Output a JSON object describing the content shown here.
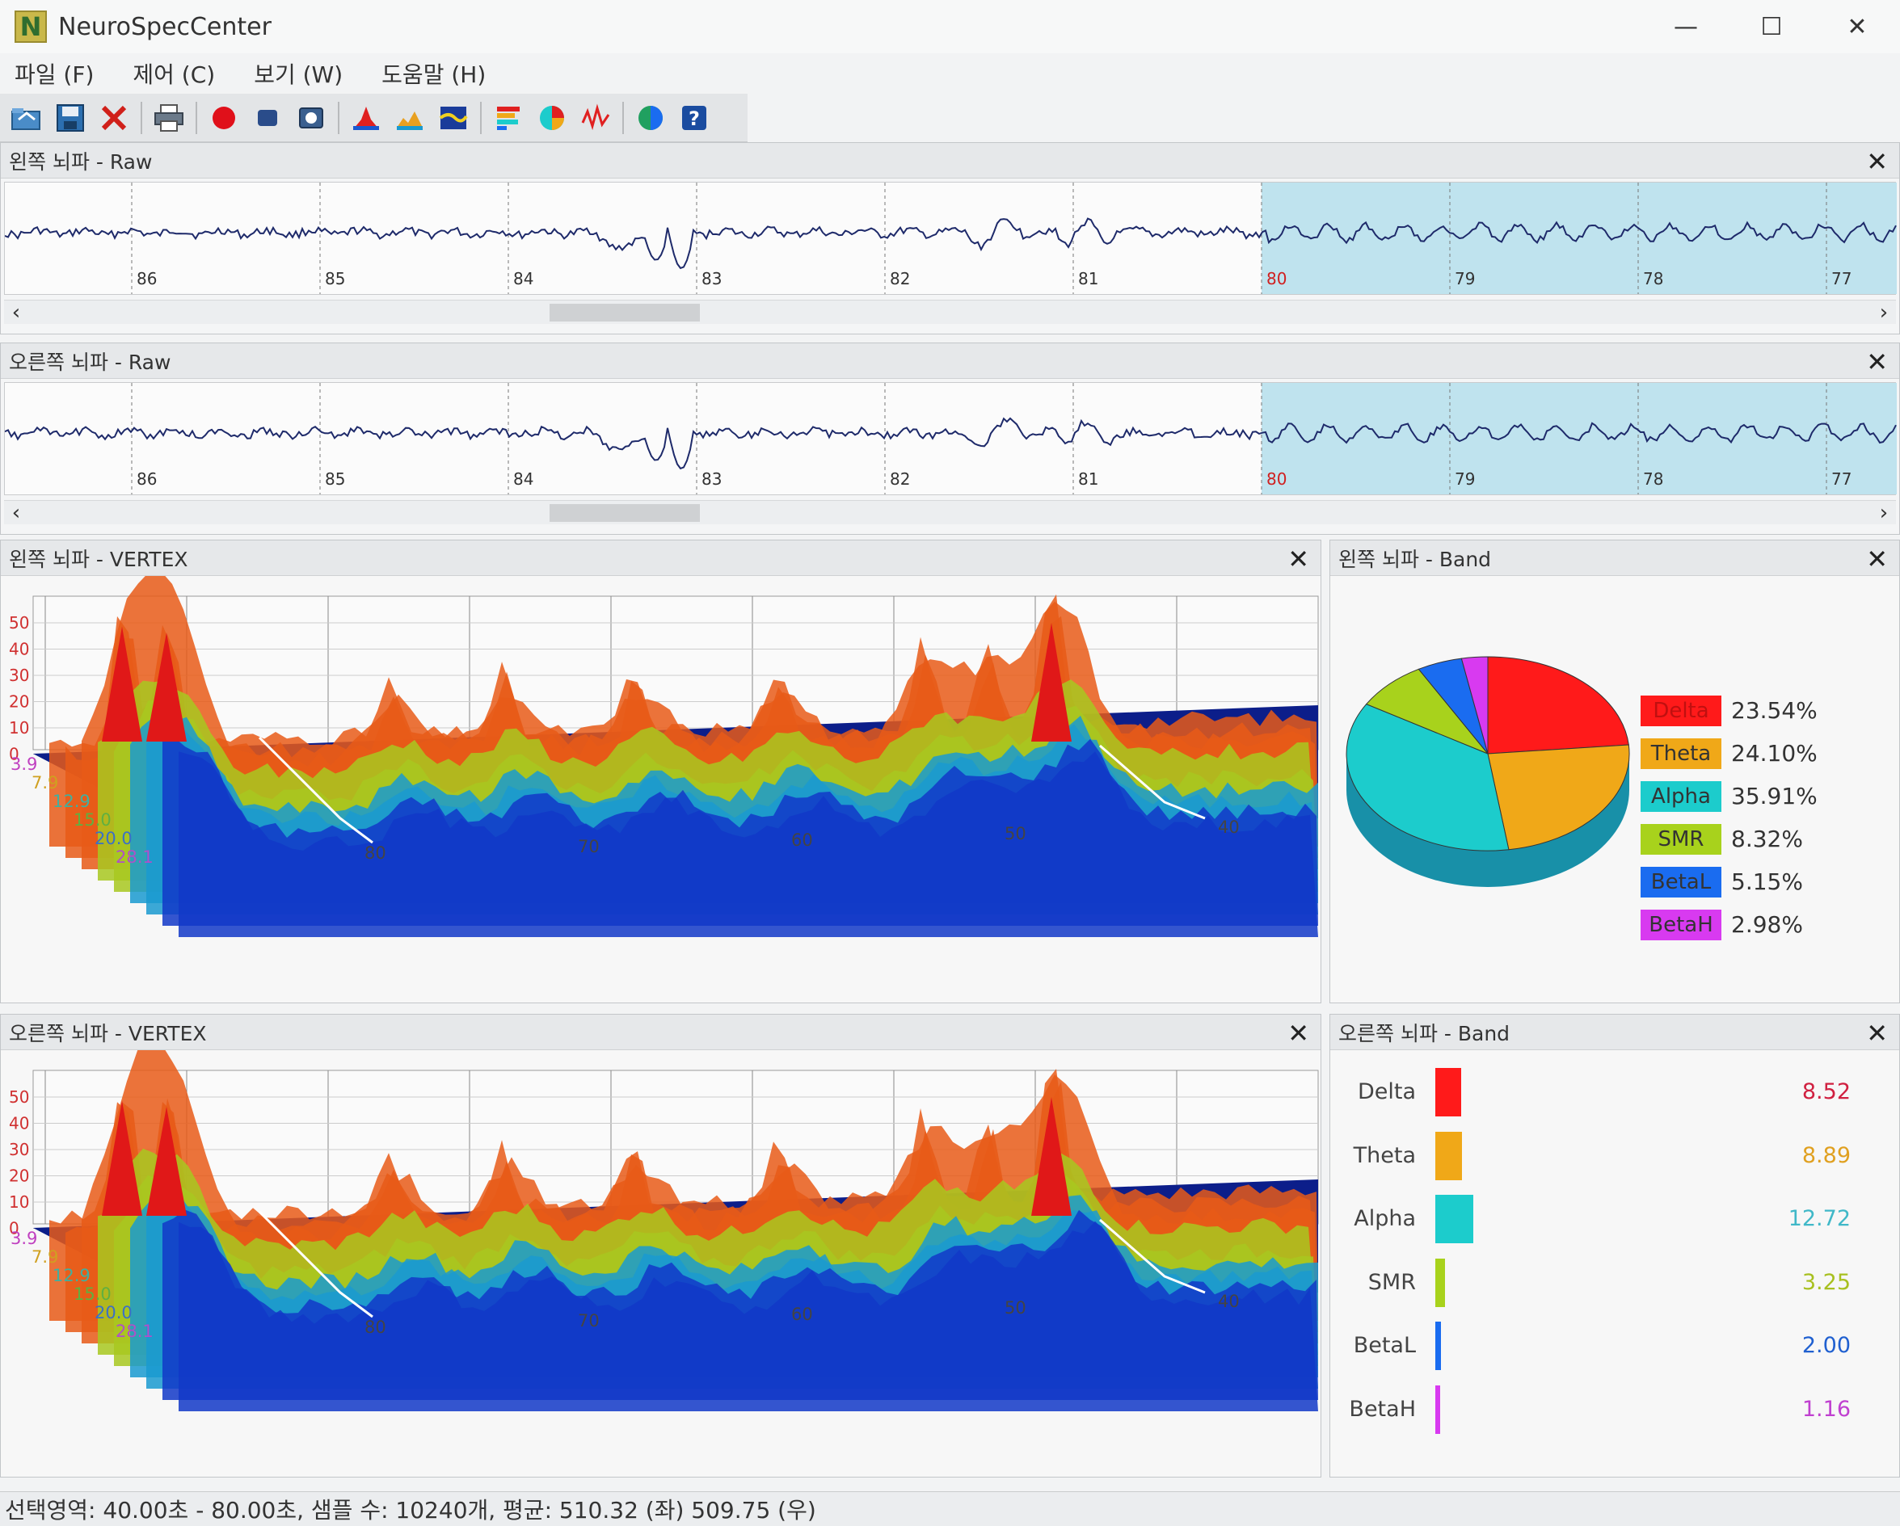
{
  "app": {
    "title": "NeuroSpecCenter",
    "logo": "N"
  },
  "window_controls": {
    "minimize": "—",
    "maximize": "☐",
    "close": "✕"
  },
  "menu": [
    "파일 (F)",
    "제어 (C)",
    "보기 (W)",
    "도움말 (H)"
  ],
  "toolbar_icons": [
    "open-icon",
    "save-icon",
    "delete-icon",
    "print-icon",
    "record-icon",
    "stop-icon",
    "capture-icon",
    "spectrum-icon",
    "landscape-icon",
    "topomap-icon",
    "band-bar-icon",
    "pie-icon",
    "wave-icon",
    "globe-icon",
    "help-icon"
  ],
  "panels": {
    "left_raw": {
      "title": "왼쪽 뇌파 - Raw",
      "ticks": [
        "86",
        "85",
        "84",
        "83",
        "82",
        "81",
        "80",
        "79",
        "78",
        "77"
      ],
      "highlight_start": "80"
    },
    "right_raw": {
      "title": "오른쪽 뇌파 - Raw",
      "ticks": [
        "86",
        "85",
        "84",
        "83",
        "82",
        "81",
        "80",
        "79",
        "78",
        "77"
      ],
      "highlight_start": "80"
    },
    "left_vertex": {
      "title": "왼쪽 뇌파 - VERTEX",
      "y_ticks": [
        "50",
        "40",
        "30",
        "20",
        "10",
        "0"
      ],
      "freq_ticks": [
        "3.9",
        "7.9",
        "12.9",
        "15.0",
        "20.0",
        "28.1"
      ],
      "time_ticks": [
        "80",
        "70",
        "60",
        "50",
        "40"
      ]
    },
    "right_vertex": {
      "title": "오른쪽 뇌파 - VERTEX",
      "y_ticks": [
        "50",
        "40",
        "30",
        "20",
        "10",
        "0"
      ],
      "freq_ticks": [
        "3.9",
        "7.9",
        "12.9",
        "15.0",
        "20.0",
        "28.1"
      ],
      "time_ticks": [
        "80",
        "70",
        "60",
        "50",
        "40"
      ]
    },
    "left_band": {
      "title": "왼쪽 뇌파 - Band"
    },
    "right_band": {
      "title": "오른쪽 뇌파 - Band"
    }
  },
  "chart_data": [
    {
      "type": "pie",
      "title": "",
      "categories": [
        "Delta",
        "Theta",
        "Alpha",
        "SMR",
        "BetaL",
        "BetaH"
      ],
      "values": [
        23.54,
        24.1,
        35.91,
        8.32,
        5.15,
        2.98
      ],
      "labels": [
        "23.54%",
        "24.10%",
        "35.91%",
        "8.32%",
        "5.15%",
        "2.98%"
      ],
      "colors": [
        "#ff1a1a",
        "#f0a818",
        "#1ccccc",
        "#a8d21c",
        "#1a6cf0",
        "#d83af0"
      ],
      "legend_placement": "right"
    },
    {
      "type": "bar",
      "title": "",
      "orientation": "horizontal",
      "categories": [
        "Delta",
        "Theta",
        "Alpha",
        "SMR",
        "BetaL",
        "BetaH"
      ],
      "values": [
        8.52,
        8.89,
        12.72,
        3.25,
        2.0,
        1.16
      ],
      "labels": [
        "8.52",
        "8.89",
        "12.72",
        "3.25",
        "2.00",
        "1.16"
      ],
      "colors": [
        "#ff1a1a",
        "#f0a818",
        "#1ccccc",
        "#a8d21c",
        "#1a6cf0",
        "#d83af0"
      ]
    }
  ],
  "status": {
    "text": "선택영역: 40.00초 - 80.00초, 샘플 수: 10240개, 평균: 510.32 (좌) 509.75 (우)"
  }
}
